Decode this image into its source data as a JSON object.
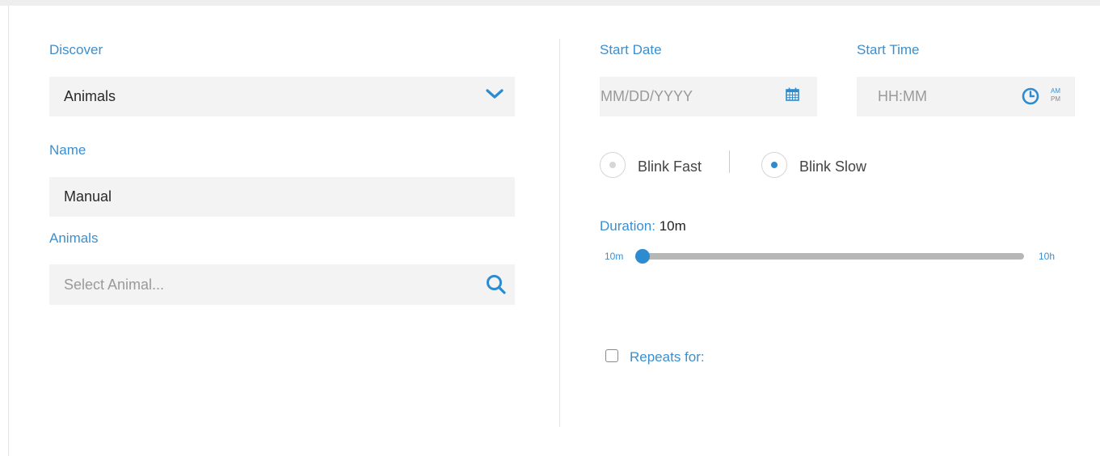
{
  "colors": {
    "accent": "#3b8fce",
    "field_bg": "#f3f3f3",
    "slider_track": "#b7b7b7"
  },
  "left": {
    "discover": {
      "label": "Discover",
      "value": "Animals",
      "icon": "chevron-down-icon"
    },
    "name": {
      "label": "Name",
      "value": "Manual"
    },
    "animals": {
      "label": "Animals",
      "placeholder": "Select Animal...",
      "icon": "search-icon"
    }
  },
  "right": {
    "start_date": {
      "label": "Start Date",
      "placeholder": "MM/DD/YYYY",
      "icon": "calendar-icon"
    },
    "start_time": {
      "label": "Start Time",
      "placeholder": "HH:MM",
      "icon": "clock-icon",
      "am": "AM",
      "pm": "PM"
    },
    "blink": {
      "options": [
        {
          "label": "Blink Fast",
          "selected": false
        },
        {
          "label": "Blink Slow",
          "selected": true
        }
      ]
    },
    "duration": {
      "label": "Duration:",
      "value": "10m",
      "min_label": "10m",
      "max_label": "10h",
      "position_fraction": 0.0
    },
    "repeats": {
      "label": "Repeats for:",
      "checked": false
    }
  }
}
